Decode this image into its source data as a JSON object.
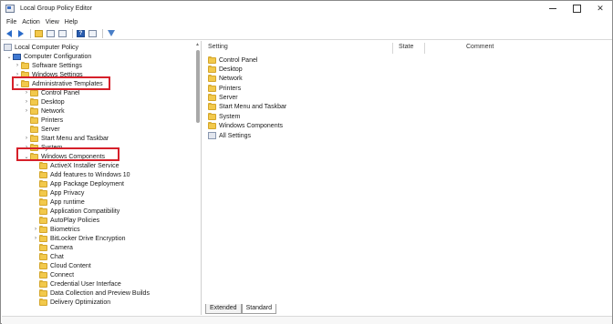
{
  "window": {
    "title": "Local Group Policy Editor"
  },
  "menu": [
    {
      "label": "File"
    },
    {
      "label": "Action"
    },
    {
      "label": "View"
    },
    {
      "label": "Help"
    }
  ],
  "tree": {
    "root": "Local Computer Policy",
    "computer_config": "Computer Configuration",
    "software_settings": "Software Settings",
    "windows_settings": "Windows Settings",
    "admin_templates": "Administrative Templates",
    "at_children": [
      "Control Panel",
      "Desktop",
      "Network",
      "Printers",
      "Server",
      "Start Menu and Taskbar",
      "System"
    ],
    "windows_components": "Windows Components",
    "wc_children": [
      "ActiveX Installer Service",
      "Add features to Windows 10",
      "App Package Deployment",
      "App Privacy",
      "App runtime",
      "Application Compatibility",
      "AutoPlay Policies",
      "Biometrics",
      "BitLocker Drive Encryption",
      "Camera",
      "Chat",
      "Cloud Content",
      "Connect",
      "Credential User Interface",
      "Data Collection and Preview Builds",
      "Delivery Optimization"
    ]
  },
  "list": {
    "columns": [
      "Setting",
      "State",
      "Comment"
    ],
    "items": [
      "Control Panel",
      "Desktop",
      "Network",
      "Printers",
      "Server",
      "Start Menu and Taskbar",
      "System",
      "Windows Components",
      "All Settings"
    ]
  },
  "tabs": [
    "Extended",
    "Standard"
  ],
  "colors": {
    "highlight": "#d6202a",
    "folder": "#f2c94c",
    "accent": "#2a6bc9"
  }
}
